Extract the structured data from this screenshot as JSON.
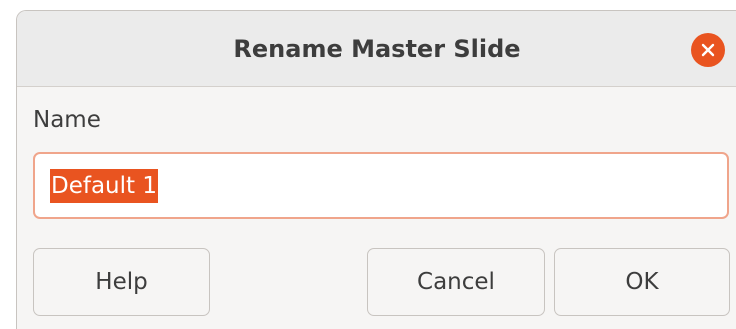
{
  "dialog": {
    "title": "Rename Master Slide",
    "close_icon": "close-icon",
    "accent_color": "#e95420"
  },
  "form": {
    "name_label": "Name",
    "name_value": "Default 1",
    "name_selected": true
  },
  "buttons": {
    "help_label": "Help",
    "cancel_label": "Cancel",
    "ok_label": "OK"
  }
}
